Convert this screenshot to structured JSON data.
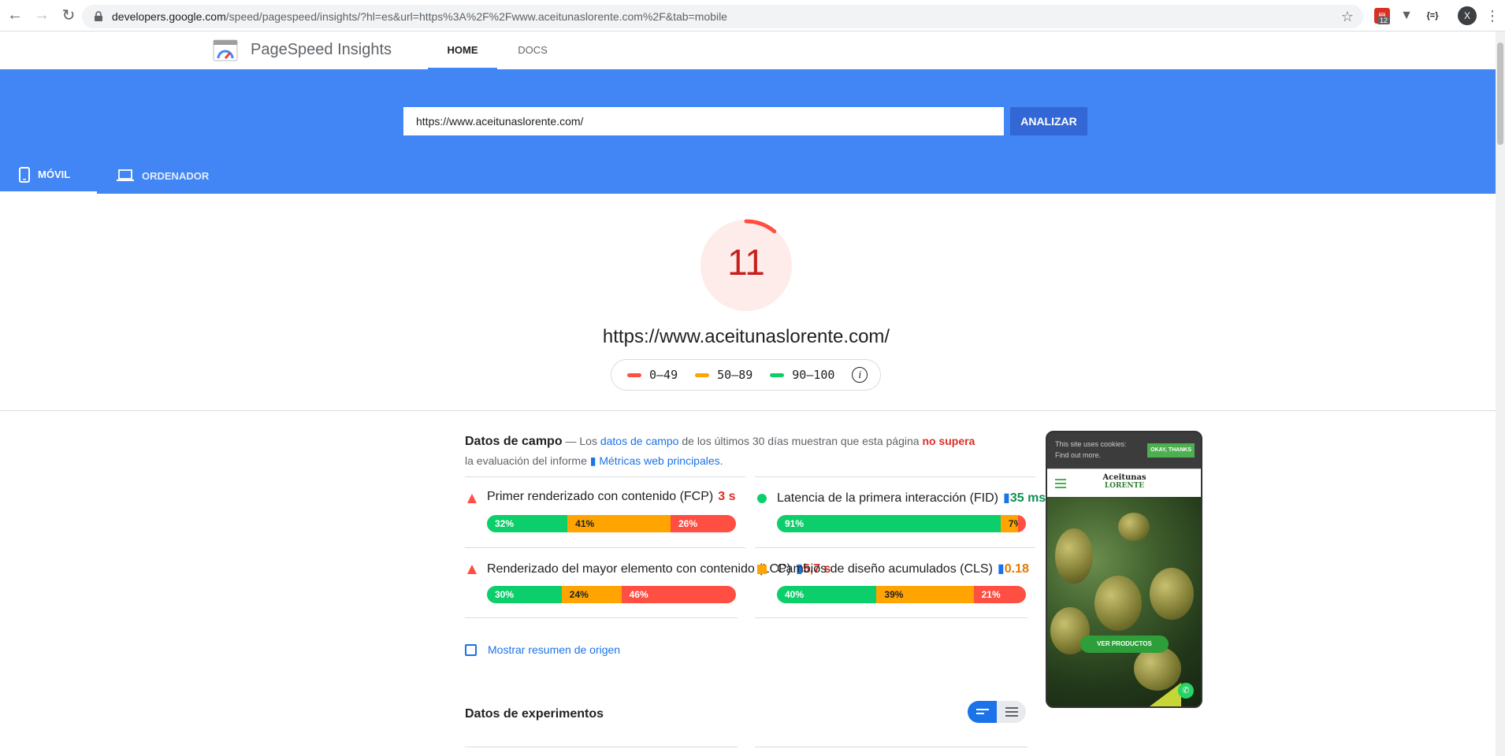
{
  "browser": {
    "url_host": "developers.google.com",
    "url_path": "/speed/pagespeed/insights/?hl=es&url=https%3A%2F%2Fwww.aceitunaslorente.com%2F&tab=mobile",
    "extension_badge": "12",
    "extension_curly": "{=}",
    "profile_initial": "X"
  },
  "header": {
    "title": "PageSpeed Insights",
    "tabs": [
      {
        "label": "HOME",
        "active": true
      },
      {
        "label": "DOCS",
        "active": false
      }
    ]
  },
  "search": {
    "value": "https://www.aceitunaslorente.com/",
    "button": "ANALIZAR"
  },
  "devices": [
    {
      "label": "MÓVIL",
      "active": true
    },
    {
      "label": "ORDENADOR",
      "active": false
    }
  ],
  "score": {
    "value": 11,
    "url": "https://www.aceitunaslorente.com/"
  },
  "legend": [
    {
      "label": "0–49",
      "color": "#ff4e42"
    },
    {
      "label": "50–89",
      "color": "#ffa400"
    },
    {
      "label": "90–100",
      "color": "#0cce6b"
    }
  ],
  "field": {
    "title": "Datos de campo",
    "dash": " — ",
    "text1": "Los ",
    "link1": "datos de campo",
    "text2": " de los últimos 30 días muestran que esta página ",
    "fail": "no supera",
    "text3": " la evaluación del informe ",
    "link2": "Métricas web principales",
    "text4": ".",
    "metrics": [
      {
        "label": "Primer renderizado con contenido (FCP)",
        "value": "3 s",
        "status": "fail",
        "segments": [
          32,
          41,
          26
        ],
        "seg_labels": [
          "32%",
          "41%",
          "26%"
        ]
      },
      {
        "label": "Latencia de la primera interacción (FID)",
        "value": "35 ms",
        "status": "pass",
        "segments": [
          91,
          7,
          2
        ],
        "seg_labels": [
          "91%",
          "7%",
          "2%"
        ]
      },
      {
        "label": "Renderizado del mayor elemento con contenido (LCP)",
        "value": "5,7 s",
        "status": "fail",
        "segments": [
          30,
          24,
          46
        ],
        "seg_labels": [
          "30%",
          "24%",
          "46%"
        ]
      },
      {
        "label": "Cambios de diseño acumulados (CLS)",
        "value": "0.18",
        "status": "average",
        "segments": [
          40,
          39,
          21
        ],
        "seg_labels": [
          "40%",
          "39%",
          "21%"
        ]
      }
    ]
  },
  "origin_summary": "Mostrar resumen de origen",
  "lab_title": "Datos de experimentos",
  "preview": {
    "cookie_line1": "This site uses cookies:",
    "cookie_line2": "Find out more.",
    "cookie_button": "OKAY, THANKS",
    "brand_line1": "Aceitunas",
    "brand_line2": "LORENTE",
    "cta": "VER PRODUCTOS"
  }
}
